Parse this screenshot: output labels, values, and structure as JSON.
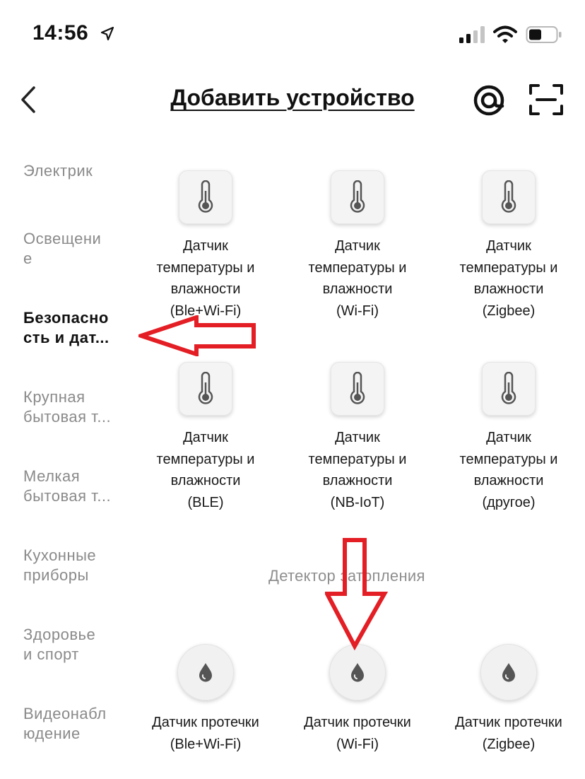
{
  "status_bar": {
    "time": "14:56",
    "icons": [
      "location-arrow-icon",
      "cellular-signal-icon",
      "wifi-icon",
      "battery-icon"
    ]
  },
  "header": {
    "title": "Добавить устройство",
    "back_icon": "chevron-left-icon",
    "at_icon": "at-sign-icon",
    "scan_icon": "scan-frame-icon"
  },
  "sidebar": {
    "items": [
      {
        "label": "Электрик"
      },
      {
        "label": "Освещени\nе"
      },
      {
        "label": "Безопасно\nсть и дат..."
      },
      {
        "label": "Крупная\nбытовая т..."
      },
      {
        "label": "Мелкая\nбытовая т..."
      },
      {
        "label": "Кухонные\nприборы"
      },
      {
        "label": "Здоровье\nи спорт"
      },
      {
        "label": "Видеонабл\nюдение"
      }
    ],
    "active_index": 2
  },
  "devices": [
    {
      "label": "Датчик\nтемпературы и\nвлажности\n(Ble+Wi-Fi)",
      "icon": "thermometer-icon"
    },
    {
      "label": "Датчик\nтемпературы и\nвлажности\n(Wi-Fi)",
      "icon": "thermometer-icon"
    },
    {
      "label": "Датчик\nтемпературы и\nвлажности\n(Zigbee)",
      "icon": "thermometer-icon"
    },
    {
      "label": "Датчик\nтемпературы и\nвлажности\n(BLE)",
      "icon": "thermometer-icon"
    },
    {
      "label": "Датчик\nтемпературы и\nвлажности\n(NB-IoT)",
      "icon": "thermometer-icon"
    },
    {
      "label": "Датчик\nтемпературы и\nвлажности\n(другое)",
      "icon": "thermometer-icon"
    }
  ],
  "flood_section": {
    "heading": "Детектор затопления",
    "devices": [
      {
        "label": "Датчик протечки\n(Ble+Wi-Fi)",
        "icon": "water-drop-icon"
      },
      {
        "label": "Датчик протечки\n(Wi-Fi)",
        "icon": "water-drop-icon"
      },
      {
        "label": "Датчик протечки\n(Zigbee)",
        "icon": "water-drop-icon"
      }
    ]
  },
  "annotations": {
    "arrow_color": "#e31e24",
    "arrows": [
      "left-arrow-annotation",
      "down-arrow-annotation"
    ]
  }
}
